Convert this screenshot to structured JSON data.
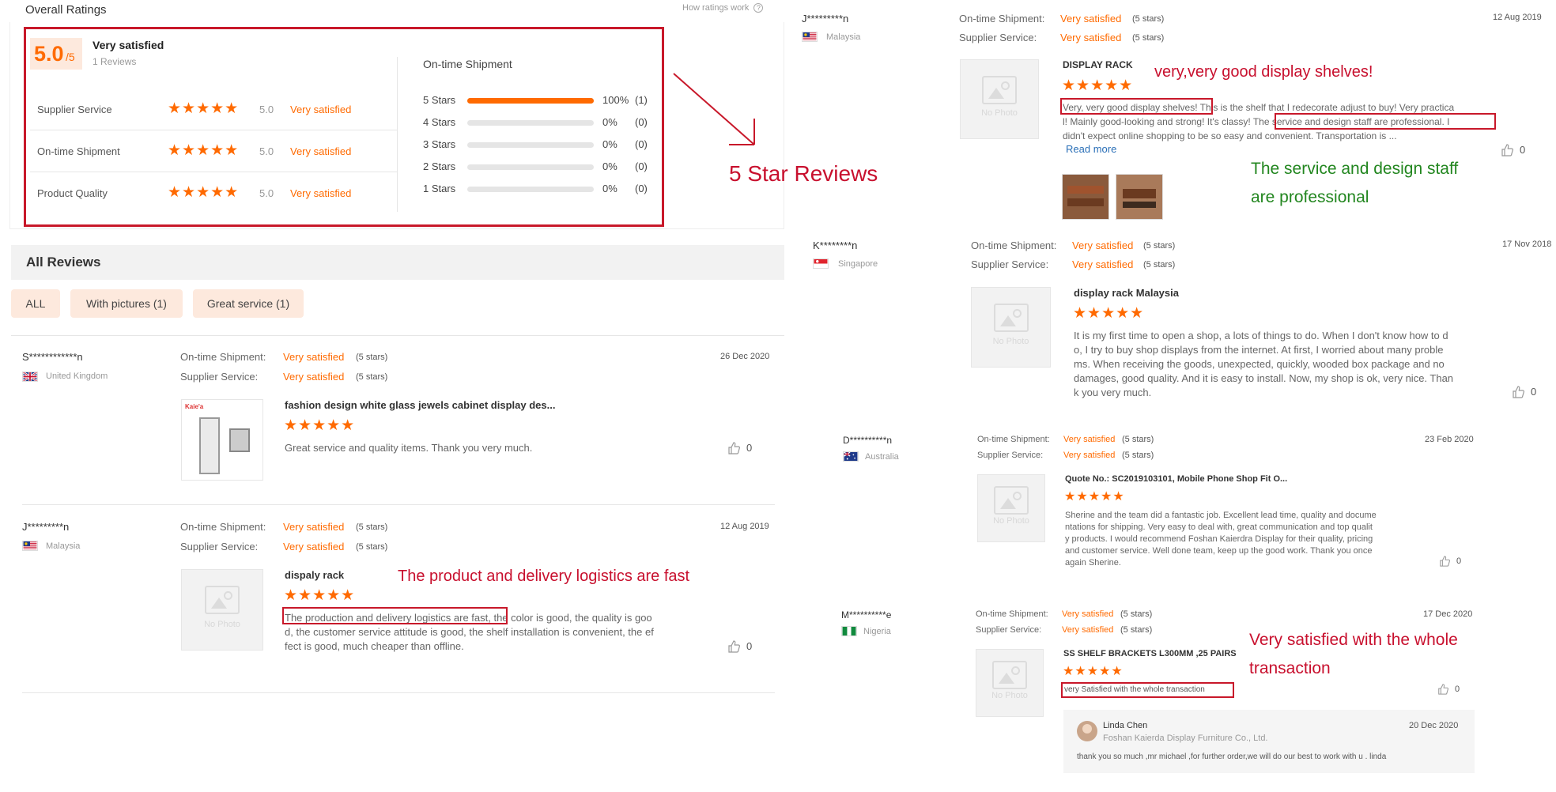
{
  "overall": {
    "title": "Overall Ratings",
    "how_link": "How ratings work",
    "score": "5.0",
    "score_suffix": "/5",
    "verdict": "Very satisfied",
    "reviews_count": "1 Reviews",
    "rows": [
      {
        "label": "Supplier Service",
        "score": "5.0",
        "verdict": "Very satisfied",
        "stars": 5
      },
      {
        "label": "On-time Shipment",
        "score": "5.0",
        "verdict": "Very satisfied",
        "stars": 5
      },
      {
        "label": "Product Quality",
        "score": "5.0",
        "verdict": "Very satisfied",
        "stars": 5
      }
    ],
    "breakdown_title": "On-time Shipment",
    "breakdown": [
      {
        "label": "5 Stars",
        "pct": "100%",
        "count": "(1)",
        "fill": 1.0
      },
      {
        "label": "4 Stars",
        "pct": "0%",
        "count": "(0)",
        "fill": 0
      },
      {
        "label": "3 Stars",
        "pct": "0%",
        "count": "(0)",
        "fill": 0
      },
      {
        "label": "2 Stars",
        "pct": "0%",
        "count": "(0)",
        "fill": 0
      },
      {
        "label": "1 Stars",
        "pct": "0%",
        "count": "(0)",
        "fill": 0
      }
    ]
  },
  "annotation_5star": "5 Star Reviews",
  "all_reviews": {
    "title": "All Reviews",
    "filters": [
      "ALL",
      "With pictures (1)",
      "Great service (1)"
    ]
  },
  "labels": {
    "shipment": "On-time Shipment:",
    "service": "Supplier Service:",
    "very_satisfied": "Very satisfied",
    "five_stars": "(5 stars)",
    "no_photo": "No Photo",
    "read_more": "Read more"
  },
  "left_reviews": [
    {
      "user": "S************n",
      "country": "United Kingdom",
      "date": "26 Dec 2020",
      "product": "fashion design white glass jewels cabinet display des...",
      "text": "Great service and quality items. Thank you very much.",
      "likes": "0"
    },
    {
      "user": "J*********n",
      "country": "Malaysia",
      "date": "12 Aug 2019",
      "product": "dispaly rack",
      "text_lines": [
        "The production and delivery logistics are fast, the color is good, the quality is goo",
        "d, the customer service attitude is good, the shelf installation is convenient, the ef",
        "fect is good, much cheaper than offline."
      ],
      "annotation": "The product and delivery logistics are fast",
      "likes": "0"
    }
  ],
  "right_reviews": [
    {
      "user": "J*********n",
      "country": "Malaysia",
      "date": "12 Aug 2019",
      "product": "DISPLAY RACK",
      "annotation": "very,very good display shelves!",
      "text_lines": [
        "Very, very good display shelves! This is the shelf that I redecorate adjust to buy! Very practica",
        "l! Mainly good-looking and strong! It's classy! The service and design staff are professional. I",
        "didn't expect online shopping to be so easy and convenient. Transportation is ..."
      ],
      "annotation2": "The service and design staff are professional",
      "likes": "0"
    },
    {
      "user": "K********n",
      "country": "Singapore",
      "date": "17 Nov 2018",
      "product": "display rack Malaysia",
      "text_lines": [
        "It is my first time to open a shop, a lots of things to do. When I don't know how to d",
        "o, I try to buy shop displays from the internet. At first, I worried about many proble",
        "ms. When receiving the goods, unexpected, quickly, wooded box package and no",
        "damages, good quality. And it is easy to install. Now, my shop is ok, very nice. Than",
        "k you very much."
      ],
      "likes": "0"
    },
    {
      "user": "D**********n",
      "country": "Australia",
      "date": "23 Feb 2020",
      "product": "Quote No.: SC2019103101, Mobile Phone Shop Fit O...",
      "text_lines": [
        "Sherine and the team did a fantastic job.  Excellent lead time, quality and docume",
        "ntations for shipping.  Very easy to deal with, great communication and top qualit",
        "y products.  I would recommend Foshan  Kaierdra Display for their quality, pricing",
        "and customer service.  Well done team, keep up the good work. Thank you once",
        "again Sherine."
      ],
      "likes": "0"
    },
    {
      "user": "M**********e",
      "country": "Nigeria",
      "date": "17 Dec 2020",
      "product": "SS SHELF BRACKETS L300MM ,25 PAIRS",
      "text": "very Satisfied with the whole transaction",
      "annotation_lines": [
        "Very satisfied with the whole",
        "transaction"
      ],
      "likes": "0",
      "reply": {
        "name": "Linda Chen",
        "company": "Foshan Kaierda Display Furniture Co., Ltd.",
        "date": "20 Dec 2020",
        "text": "thank you so much ,mr michael ,for further order,we will do our best to work with u . linda"
      }
    }
  ],
  "annotation_service_lines": [
    "The service and design staff",
    "are professional"
  ]
}
